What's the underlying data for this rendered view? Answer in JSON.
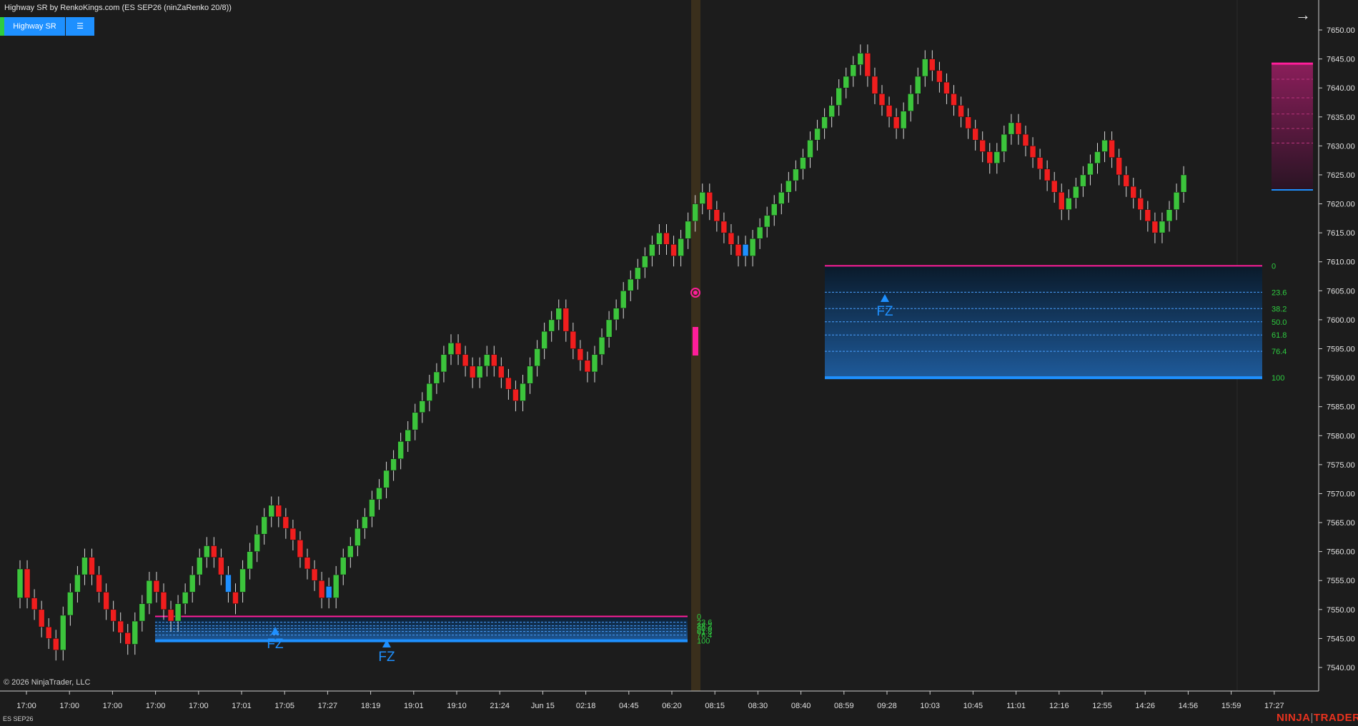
{
  "window": {
    "title": "Highway SR by RenkoKings.com (ES SEP26 (ninZaRenko 20/8))"
  },
  "toolbar": {
    "indicator_button": "Highway SR",
    "menu_button": "☰"
  },
  "nav": {
    "arrow_icon": "arrow-right-icon"
  },
  "footer": {
    "copyright": "© 2026 NinjaTrader, LLC",
    "instrument": "ES SEP26",
    "logo_left": "NINJA",
    "logo_right": "TRADER"
  },
  "colors": {
    "up": "#3cc43c",
    "down": "#f01e1e",
    "signal": "#1e90ff",
    "pink": "#ff1e9a",
    "zone_blue": "#1e5a9a",
    "fib_text": "#2ecc40"
  },
  "chart_data": {
    "type": "candlestick",
    "y_axis": {
      "min": 7540,
      "max": 7650,
      "ticks": [
        7540,
        7545,
        7550,
        7555,
        7560,
        7565,
        7570,
        7575,
        7580,
        7585,
        7590,
        7595,
        7600,
        7605,
        7610,
        7615,
        7620,
        7625,
        7630,
        7635,
        7640,
        7645,
        7650
      ],
      "tick_labels": [
        "7540.00",
        "7545.00",
        "7550.00",
        "7555.00",
        "7560.00",
        "7565.00",
        "7570.00",
        "7575.00",
        "7580.00",
        "7585.00",
        "7590.00",
        "7595.00",
        "7600.00",
        "7605.00",
        "7610.00",
        "7615.00",
        "7620.00",
        "7625.00",
        "7630.00",
        "7635.00",
        "7640.00",
        "7645.00",
        "7650.00"
      ]
    },
    "x_labels": [
      "17:00",
      "17:00",
      "17:00",
      "17:00",
      "17:00",
      "17:01",
      "17:05",
      "17:27",
      "18:19",
      "19:01",
      "19:10",
      "21:24",
      "Jun 15",
      "02:18",
      "04:45",
      "06:20",
      "08:15",
      "08:30",
      "08:40",
      "08:59",
      "09:28",
      "10:03",
      "10:45",
      "11:01",
      "12:16",
      "12:55",
      "14:26",
      "14:56",
      "15:59",
      "17:27"
    ],
    "closes": [
      7557,
      7552,
      7550,
      7547,
      7545,
      7543,
      7549,
      7553,
      7556,
      7559,
      7556,
      7553,
      7550,
      7548,
      7546,
      7544,
      7548,
      7551,
      7555,
      7553,
      7550,
      7548,
      7551,
      7553,
      7556,
      7559,
      7561,
      7559,
      7556,
      7553,
      7553,
      7557,
      7560,
      7563,
      7566,
      7568,
      7566,
      7564,
      7562,
      7559,
      7557,
      7555,
      7552,
      7552,
      7556,
      7559,
      7561,
      7564,
      7566,
      7569,
      7571,
      7574,
      7576,
      7579,
      7581,
      7584,
      7586,
      7589,
      7591,
      7594,
      7596,
      7594,
      7592,
      7590,
      7592,
      7594,
      7592,
      7590,
      7588,
      7586,
      7589,
      7592,
      7595,
      7598,
      7600,
      7602,
      7598,
      7595,
      7593,
      7591,
      7594,
      7597,
      7600,
      7602,
      7605,
      7607,
      7609,
      7611,
      7613,
      7615,
      7613,
      7611,
      7614,
      7617,
      7620,
      7622,
      7619,
      7617,
      7615,
      7613,
      7611,
      7611,
      7614,
      7616,
      7618,
      7620,
      7622,
      7624,
      7626,
      7628,
      7631,
      7633,
      7635,
      7637,
      7640,
      7642,
      7644,
      7646,
      7642,
      7639,
      7637,
      7635,
      7633,
      7636,
      7639,
      7642,
      7645,
      7643,
      7641,
      7639,
      7637,
      7635,
      7633,
      7631,
      7629,
      7627,
      7629,
      7632,
      7634,
      7632,
      7630,
      7628,
      7626,
      7624,
      7622,
      7619,
      7621,
      7623,
      7625,
      7627,
      7629,
      7631,
      7628,
      7625,
      7623,
      7621,
      7619,
      7617,
      7615,
      7617,
      7619,
      7622,
      7625
    ],
    "zones": [
      {
        "label_top": "0",
        "levels": [
          "23.6",
          "38.2",
          "50.0",
          "61.8",
          "76.4"
        ],
        "label_bottom": "100",
        "top": 7548.8,
        "bottom": 7544.6,
        "marker": "FZ"
      },
      {
        "label_top": "0",
        "levels": [
          "23.6",
          "38.2",
          "50.0",
          "61.8",
          "76.4"
        ],
        "label_bottom": "100",
        "top": 7609.3,
        "bottom": 7590.0,
        "marker": "FZ"
      }
    ],
    "markers": [
      "FZ",
      "FZ",
      "FZ"
    ]
  }
}
